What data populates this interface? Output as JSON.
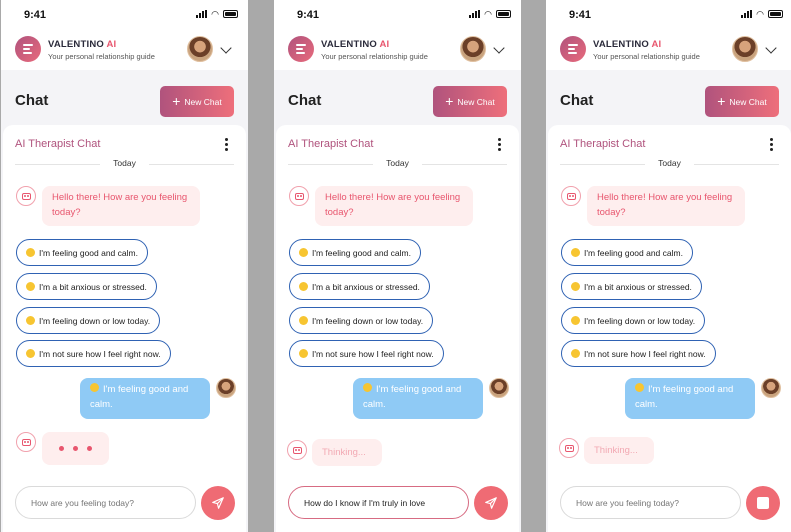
{
  "colors": {
    "accent": "#e8566e",
    "brand": "#b0537d",
    "user_bubble": "#8fcaf5",
    "option_border": "#2f62b3"
  },
  "status_bar": {
    "time": "9:41"
  },
  "header": {
    "brand_name": "VALENTINO",
    "brand_ai": "AI",
    "tagline": "Your personal relationship guide"
  },
  "page": {
    "title": "Chat",
    "new_chat_label": "New Chat"
  },
  "chat": {
    "title": "AI Therapist Chat",
    "day_label": "Today",
    "bot_greeting": "Hello there! How are you feeling today?",
    "options": [
      "I'm feeling good and calm.",
      "I'm a bit anxious or stressed.",
      "I'm feeling down or low today.",
      "I'm not sure how I feel right now."
    ],
    "user_message": "I'm feeling good and calm.",
    "thinking_text": "Thinking...",
    "input_placeholder": "How are you feeling today?"
  },
  "screens": [
    {
      "state": "typing",
      "input_value": ""
    },
    {
      "state": "thinking",
      "input_value": "How do I know if I'm truly in love"
    },
    {
      "state": "thinking",
      "input_value": ""
    }
  ]
}
